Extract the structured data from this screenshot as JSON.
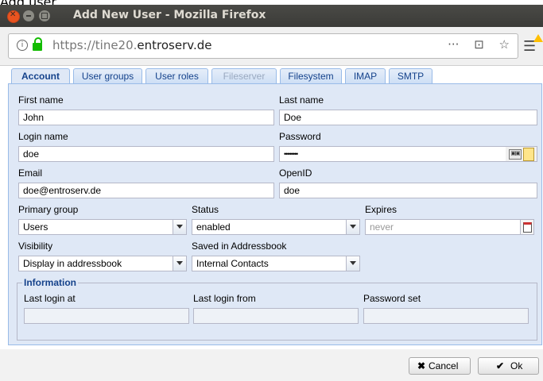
{
  "background": {
    "title_fragment": "Add user"
  },
  "window": {
    "title": "Add New User - Mozilla Firefox"
  },
  "urlbar": {
    "url_prefix": "https://tine20.",
    "url_domain": "entroserv.de",
    "more": "···",
    "pocket": "⊡",
    "star": "☆"
  },
  "tabs": [
    {
      "label": "Account",
      "state": "active"
    },
    {
      "label": "User groups",
      "state": "normal"
    },
    {
      "label": "User roles",
      "state": "normal"
    },
    {
      "label": "Fileserver",
      "state": "disabled"
    },
    {
      "label": "Filesystem",
      "state": "normal"
    },
    {
      "label": "IMAP",
      "state": "normal"
    },
    {
      "label": "SMTP",
      "state": "normal"
    }
  ],
  "form": {
    "first_name": {
      "label": "First name",
      "value": "John"
    },
    "last_name": {
      "label": "Last name",
      "value": "Doe"
    },
    "login_name": {
      "label": "Login name",
      "value": "doe"
    },
    "password": {
      "label": "Password",
      "value": "••••••••"
    },
    "email": {
      "label": "Email",
      "value": "doe@entroserv.de"
    },
    "openid": {
      "label": "OpenID",
      "value": "doe"
    },
    "primary_group": {
      "label": "Primary group",
      "value": "Users"
    },
    "status": {
      "label": "Status",
      "value": "enabled"
    },
    "expires": {
      "label": "Expires",
      "placeholder": "never"
    },
    "visibility": {
      "label": "Visibility",
      "value": "Display in addressbook"
    },
    "saved_in": {
      "label": "Saved in Addressbook",
      "value": "Internal Contacts"
    }
  },
  "information": {
    "legend": "Information",
    "last_login_at": {
      "label": "Last login at",
      "value": ""
    },
    "last_login_from": {
      "label": "Last login from",
      "value": ""
    },
    "password_set": {
      "label": "Password set",
      "value": ""
    }
  },
  "buttons": {
    "cancel": {
      "icon": "✖",
      "label": "Cancel"
    },
    "ok": {
      "icon": "✔",
      "label": "Ok"
    }
  },
  "colors": {
    "accent": "#15428b",
    "panel": "#dfe8f6",
    "titlebar": "#3b3b38",
    "close": "#e95420"
  }
}
